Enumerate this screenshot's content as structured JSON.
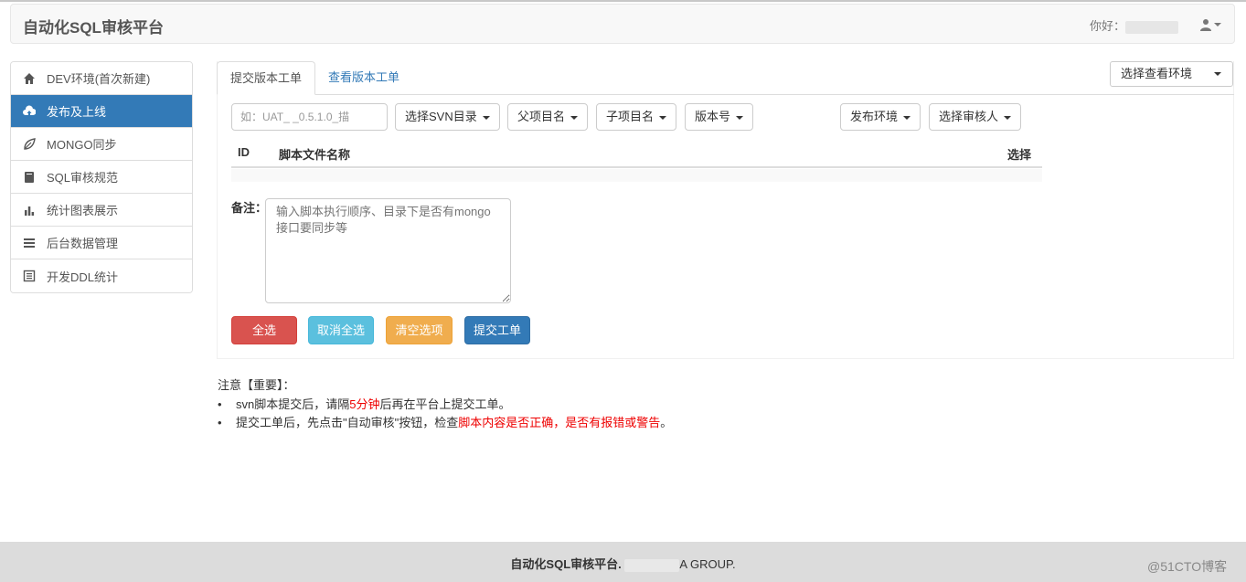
{
  "app": {
    "brand": "自动化SQL审核平台",
    "greeting": "你好："
  },
  "sidebar": {
    "items": [
      {
        "label": "DEV环境(首次新建)",
        "icon": "home-icon",
        "active": false
      },
      {
        "label": "发布及上线",
        "icon": "cloud-upload-icon",
        "active": true
      },
      {
        "label": "MONGO同步",
        "icon": "leaf-icon",
        "active": false
      },
      {
        "label": "SQL审核规范",
        "icon": "book-icon",
        "active": false
      },
      {
        "label": "统计图表展示",
        "icon": "bar-chart-icon",
        "active": false
      },
      {
        "label": "后台数据管理",
        "icon": "list-icon",
        "active": false
      },
      {
        "label": "开发DDL统计",
        "icon": "document-list-icon",
        "active": false
      }
    ]
  },
  "tabs": {
    "submit": "提交版本工单",
    "view": "查看版本工单"
  },
  "env_select": {
    "label": "选择查看环境"
  },
  "form": {
    "version_placeholder": "如：UAT_        _0.5.1.0_描",
    "svn_dir": "选择SVN目录",
    "parent_dir": "父项目名",
    "child_dir": "子项目名",
    "version_no": "版本号",
    "release_env": "发布环境",
    "reviewer": "选择审核人"
  },
  "table": {
    "col_id": "ID",
    "col_name": "脚本文件名称",
    "col_select": "选择"
  },
  "remark": {
    "label": "备注：",
    "placeholder": "输入脚本执行顺序、目录下是否有mongo接口要同步等"
  },
  "buttons": {
    "select_all": "全选",
    "deselect_all": "取消全选",
    "clear": "清空选项",
    "submit": "提交工单"
  },
  "notice": {
    "title": "注意【重要】：",
    "line1_a": "svn脚本提交后，请隔",
    "line1_red": "5分钟",
    "line1_b": "后再在平台上提交工单。",
    "line2_a": "提交工单后，先点击\"自动审核\"按钮，检查",
    "line2_red": "脚本内容是否正确，是否有报错或警告",
    "line2_b": "。"
  },
  "footer": {
    "brand": "自动化SQL审核平台.",
    "suffix": "A GROUP.",
    "watermark": "@51CTO博客"
  },
  "colors": {
    "primary": "#337ab7",
    "danger": "#d9534f",
    "info": "#5bc0de",
    "warning": "#f0ad4e"
  }
}
